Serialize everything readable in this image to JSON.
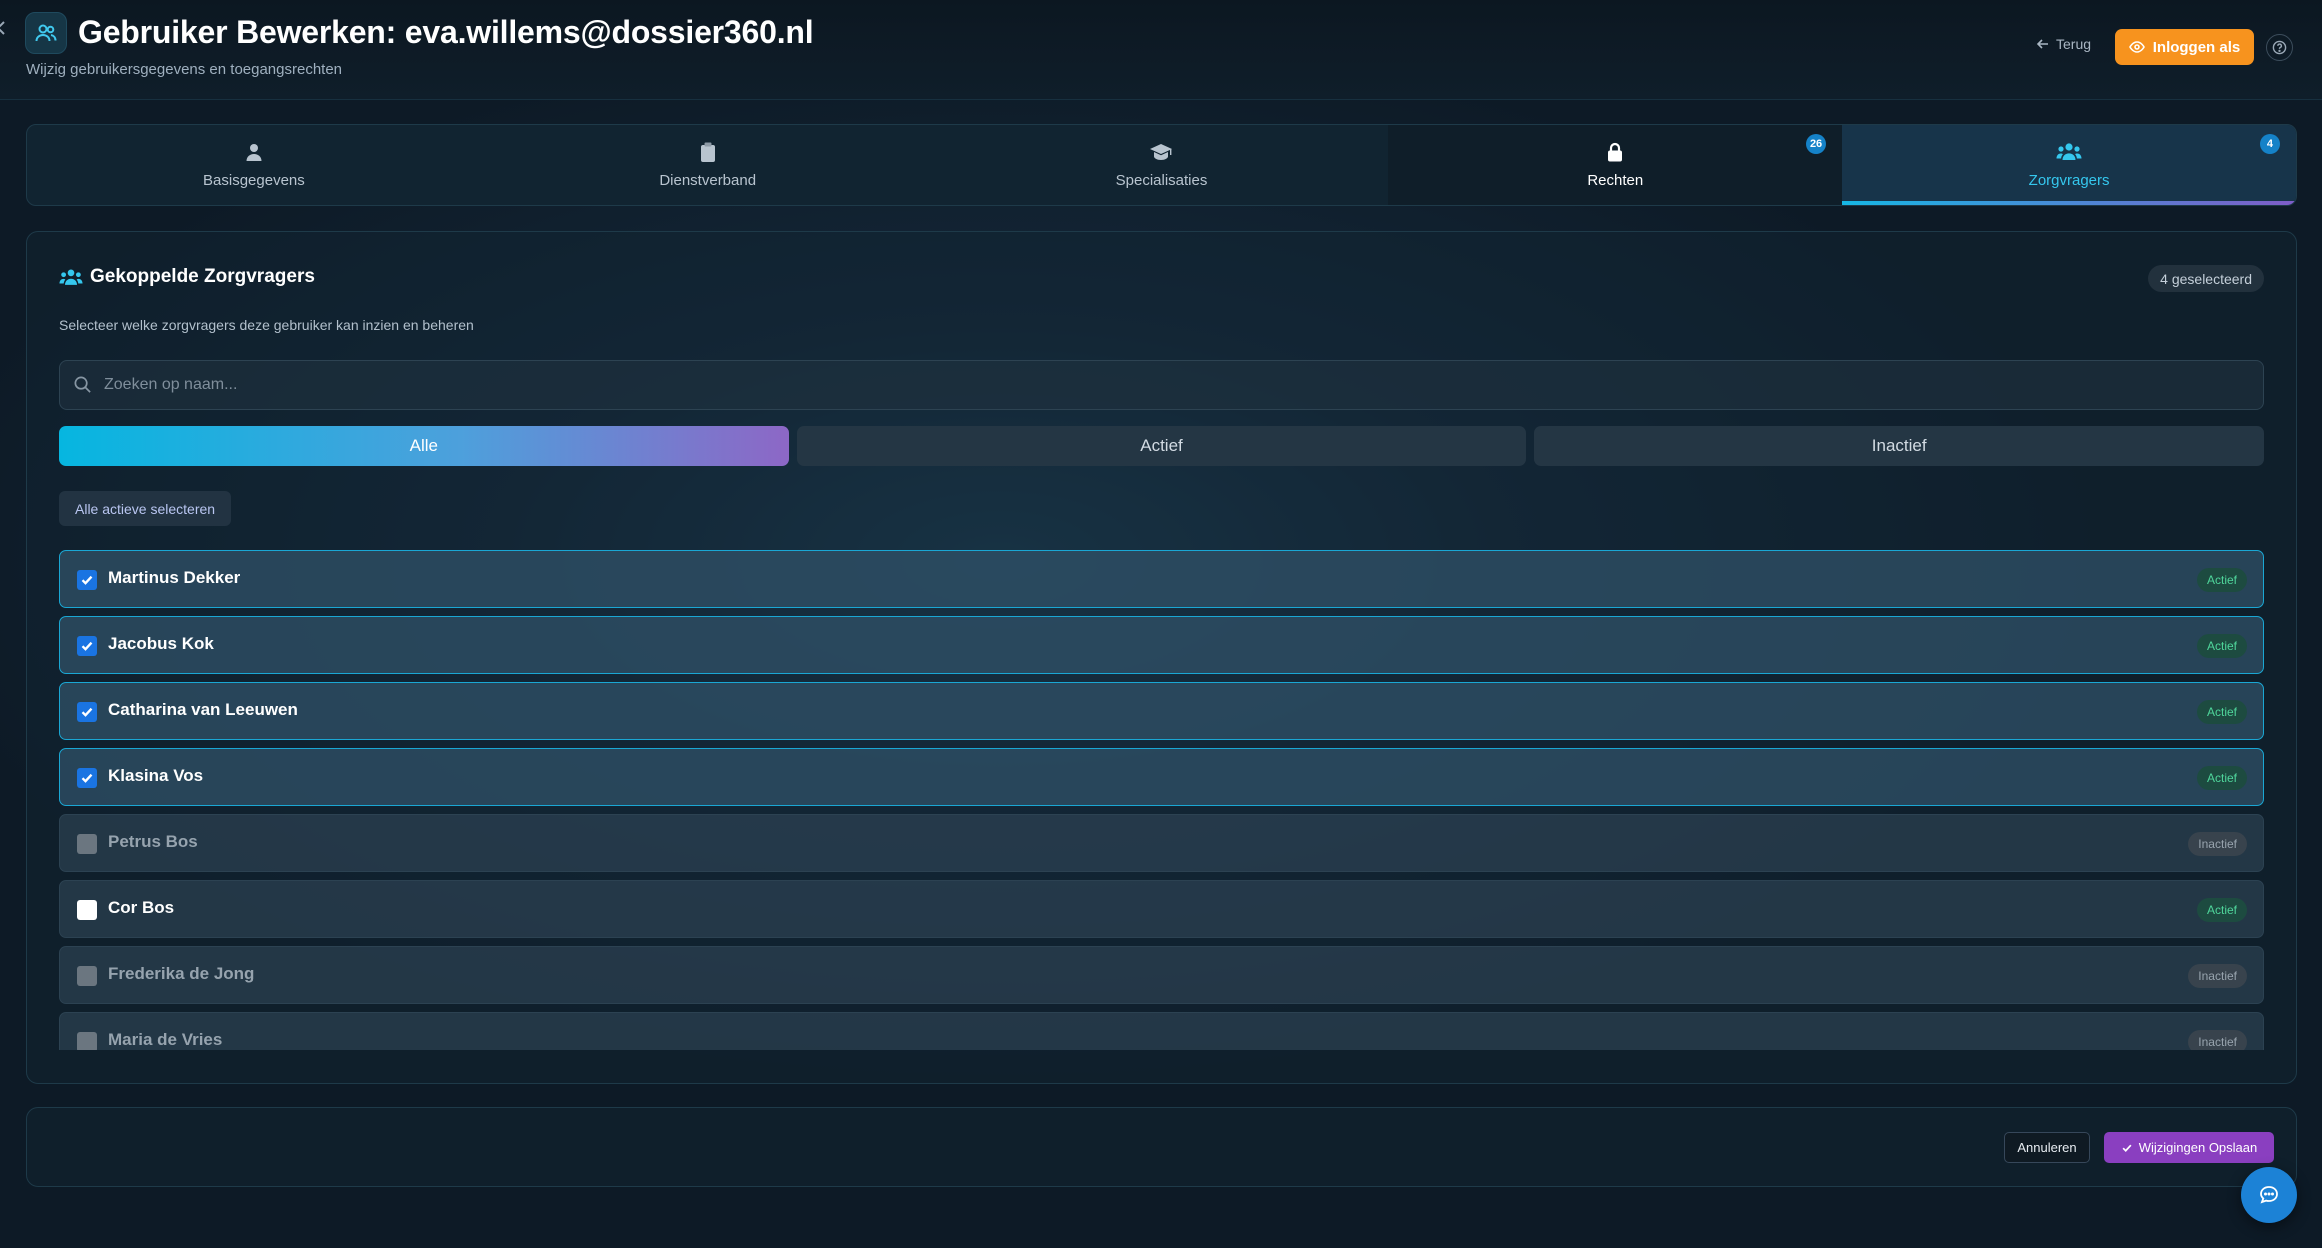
{
  "header": {
    "title": "Gebruiker Bewerken: eva.willems@dossier360.nl",
    "subtitle": "Wijzig gebruikersgegevens en toegangsrechten",
    "back_label": "Terug",
    "login_as_label": "Inloggen als",
    "icons": {
      "title": "users-icon",
      "back": "arrow-left-icon",
      "login": "eye-icon",
      "help": "help-circle-icon"
    }
  },
  "tabs": [
    {
      "label": "Basisgegevens",
      "icon": "user-icon"
    },
    {
      "label": "Dienstverband",
      "icon": "clipboard-icon"
    },
    {
      "label": "Specialisaties",
      "icon": "graduation-cap-icon"
    },
    {
      "label": "Rechten",
      "icon": "lock-icon",
      "badge": "26"
    },
    {
      "label": "Zorgvragers",
      "icon": "users-icon",
      "badge": "4",
      "active": true
    }
  ],
  "section": {
    "title": "Gekoppelde Zorgvragers",
    "selected_count": "4 geselecteerd",
    "description": "Selecteer welke zorgvragers deze gebruiker kan inzien en beheren",
    "search_placeholder": "Zoeken op naam...",
    "filters": [
      {
        "label": "Alle",
        "active": true
      },
      {
        "label": "Actief",
        "active": false
      },
      {
        "label": "Inactief",
        "active": false
      }
    ],
    "select_all_label": "Alle actieve selecteren",
    "items": [
      {
        "name": "Martinus Dekker",
        "status": "Actief",
        "checked": true
      },
      {
        "name": "Jacobus Kok",
        "status": "Actief",
        "checked": true
      },
      {
        "name": "Catharina van Leeuwen",
        "status": "Actief",
        "checked": true
      },
      {
        "name": "Klasina Vos",
        "status": "Actief",
        "checked": true
      },
      {
        "name": "Petrus Bos",
        "status": "Inactief",
        "checked": false
      },
      {
        "name": "Cor Bos",
        "status": "Actief",
        "checked": false
      },
      {
        "name": "Frederika de Jong",
        "status": "Inactief",
        "checked": false
      },
      {
        "name": "Maria de Vries",
        "status": "Inactief",
        "checked": false
      }
    ]
  },
  "footer": {
    "cancel_label": "Annuleren",
    "save_label": "Wijzigingen Opslaan"
  },
  "colors": {
    "accent": "#35c7ee",
    "login_button": "#f7931e",
    "save_button": "#8a3fc0",
    "checkbox_checked": "#1a74e2",
    "status_active": "#4fd69b"
  }
}
